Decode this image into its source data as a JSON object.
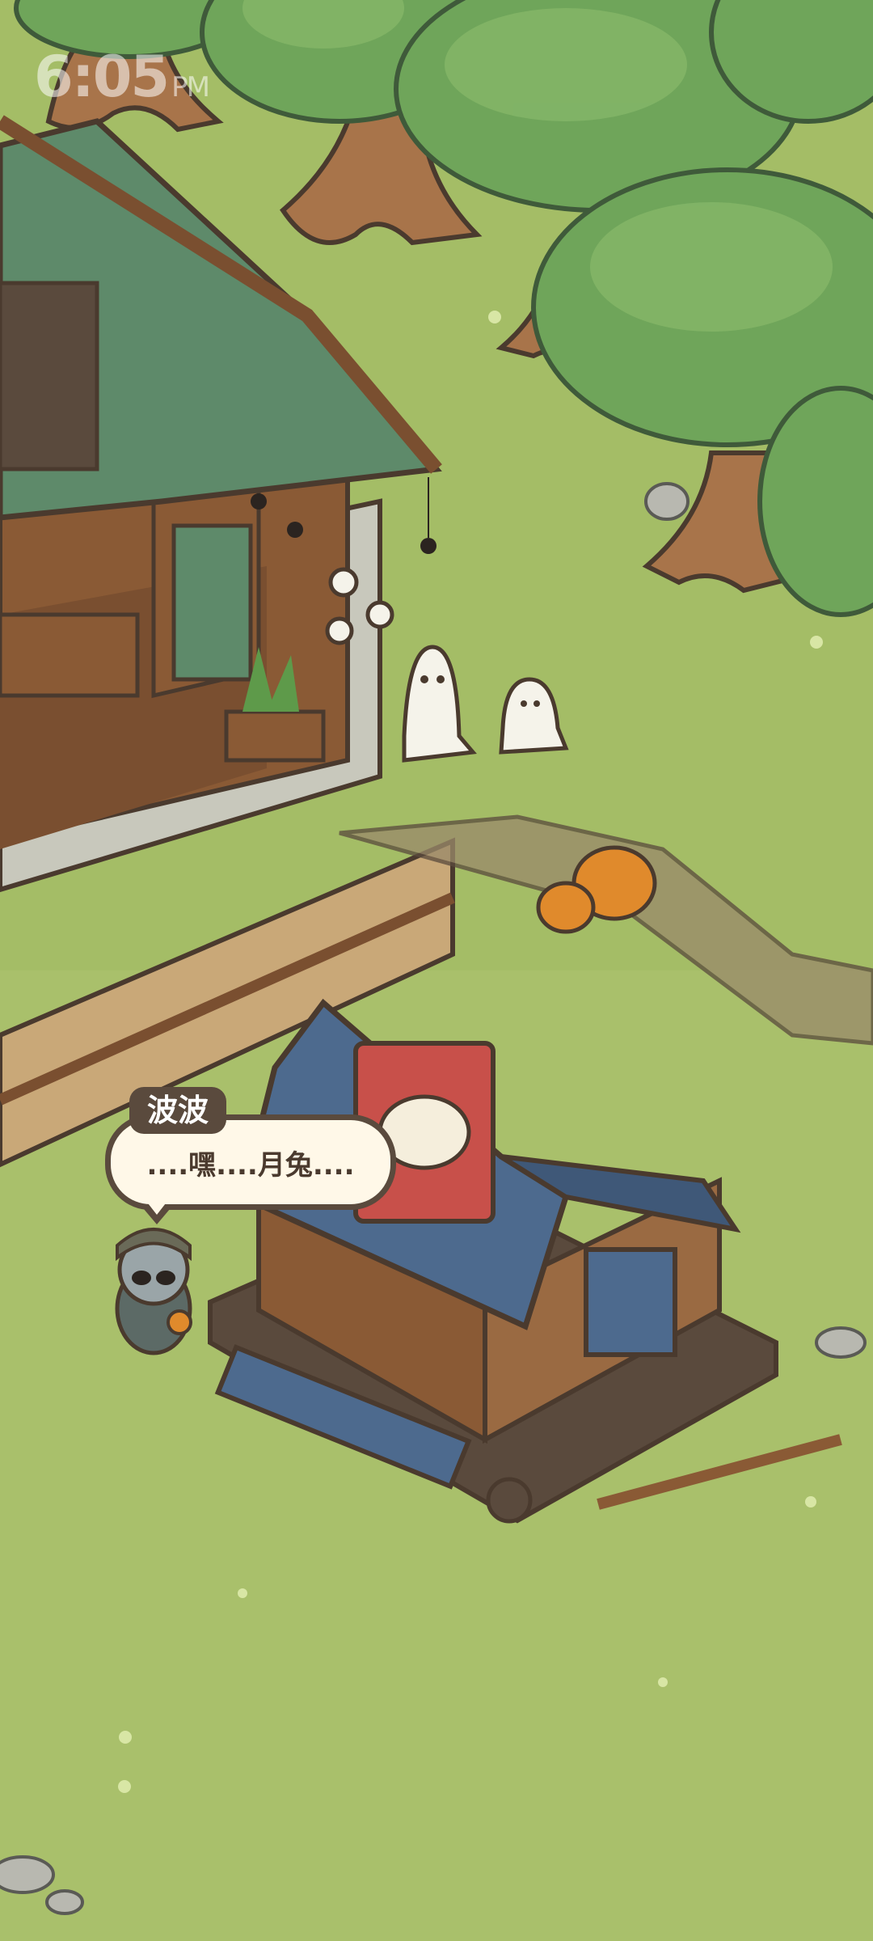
{
  "status_bar": {
    "time": "6:05",
    "ampm": "PM"
  },
  "dialog": {
    "speaker": "波波",
    "text": "....嘿....月兔...."
  },
  "colors": {
    "grass": "#a9c06b",
    "tree": "#6fa55a",
    "roof_green": "#5e8a6a",
    "roof_blue": "#4d6a8e",
    "wood": "#8a5a35",
    "outline": "#4a3a2e",
    "pumpkin": "#e08a2c"
  }
}
